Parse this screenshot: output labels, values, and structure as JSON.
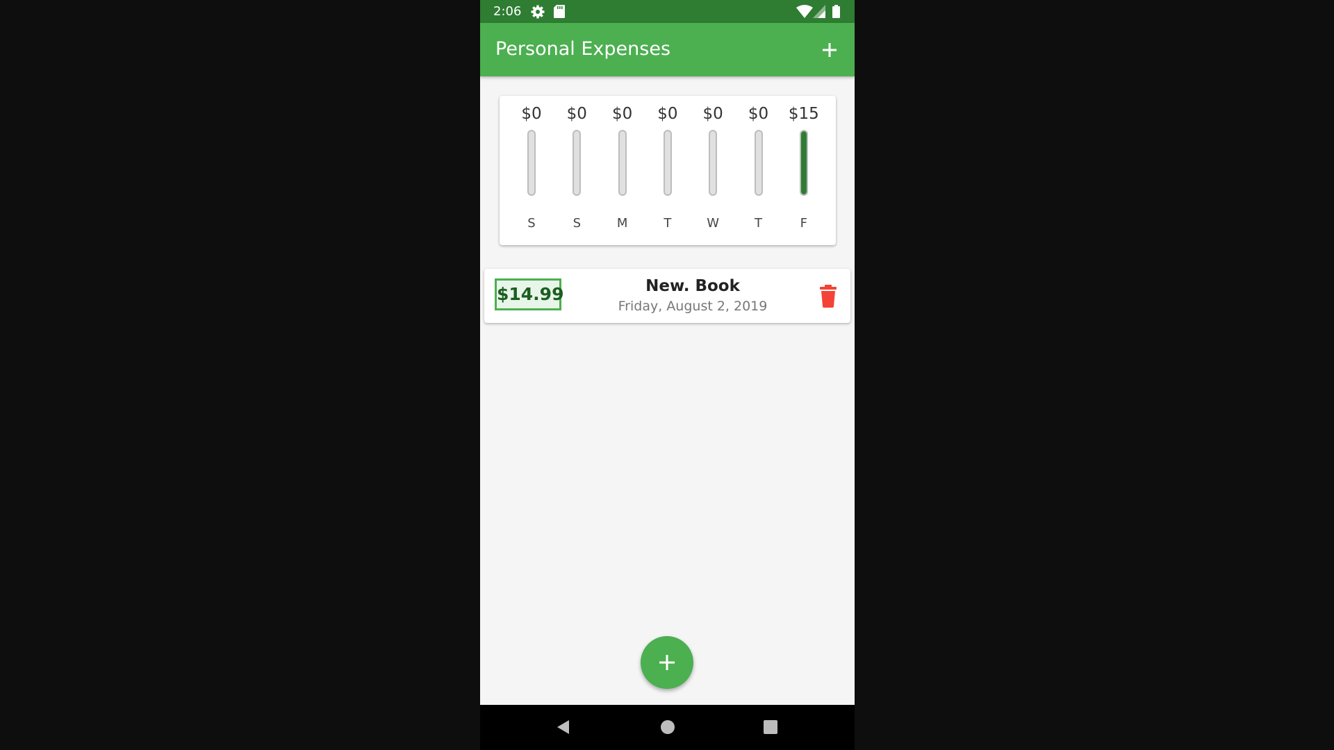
{
  "status_bar": {
    "time": "2:06",
    "icons": [
      "gear-icon",
      "sd-card-icon",
      "wifi-icon",
      "signal-icon",
      "battery-icon"
    ]
  },
  "app_bar": {
    "title": "Personal Expenses",
    "add_icon": "plus-icon"
  },
  "chart_data": {
    "type": "bar",
    "categories": [
      "S",
      "S",
      "M",
      "T",
      "W",
      "T",
      "F"
    ],
    "value_labels": [
      "$0",
      "$0",
      "$0",
      "$0",
      "$0",
      "$0",
      "$15"
    ],
    "values": [
      0,
      0,
      0,
      0,
      0,
      0,
      14.99
    ],
    "fill_fraction": [
      0,
      0,
      0,
      0,
      0,
      0,
      1.0
    ],
    "bar_color": "#2e7d32",
    "track_color": "#e0e0e0"
  },
  "transactions": [
    {
      "amount": "$14.99",
      "title": "New. Book",
      "date": "Friday, August 2, 2019",
      "delete_icon": "trash-icon"
    }
  ],
  "fab": {
    "icon": "plus-icon"
  },
  "nav_bar": {
    "icons": [
      "back-icon",
      "home-icon",
      "recents-icon"
    ]
  },
  "colors": {
    "primary": "#4caf50",
    "primary_dark": "#2e7d32",
    "delete": "#f44336"
  }
}
